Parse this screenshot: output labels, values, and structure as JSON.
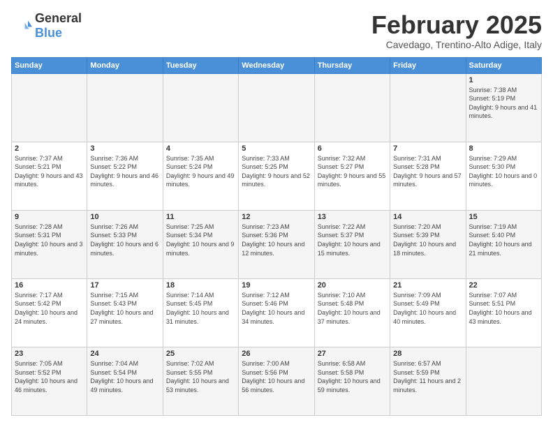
{
  "header": {
    "logo_general": "General",
    "logo_blue": "Blue",
    "month_title": "February 2025",
    "subtitle": "Cavedago, Trentino-Alto Adige, Italy"
  },
  "days_of_week": [
    "Sunday",
    "Monday",
    "Tuesday",
    "Wednesday",
    "Thursday",
    "Friday",
    "Saturday"
  ],
  "weeks": [
    [
      {
        "day": "",
        "info": ""
      },
      {
        "day": "",
        "info": ""
      },
      {
        "day": "",
        "info": ""
      },
      {
        "day": "",
        "info": ""
      },
      {
        "day": "",
        "info": ""
      },
      {
        "day": "",
        "info": ""
      },
      {
        "day": "1",
        "info": "Sunrise: 7:38 AM\nSunset: 5:19 PM\nDaylight: 9 hours and 41 minutes."
      }
    ],
    [
      {
        "day": "2",
        "info": "Sunrise: 7:37 AM\nSunset: 5:21 PM\nDaylight: 9 hours and 43 minutes."
      },
      {
        "day": "3",
        "info": "Sunrise: 7:36 AM\nSunset: 5:22 PM\nDaylight: 9 hours and 46 minutes."
      },
      {
        "day": "4",
        "info": "Sunrise: 7:35 AM\nSunset: 5:24 PM\nDaylight: 9 hours and 49 minutes."
      },
      {
        "day": "5",
        "info": "Sunrise: 7:33 AM\nSunset: 5:25 PM\nDaylight: 9 hours and 52 minutes."
      },
      {
        "day": "6",
        "info": "Sunrise: 7:32 AM\nSunset: 5:27 PM\nDaylight: 9 hours and 55 minutes."
      },
      {
        "day": "7",
        "info": "Sunrise: 7:31 AM\nSunset: 5:28 PM\nDaylight: 9 hours and 57 minutes."
      },
      {
        "day": "8",
        "info": "Sunrise: 7:29 AM\nSunset: 5:30 PM\nDaylight: 10 hours and 0 minutes."
      }
    ],
    [
      {
        "day": "9",
        "info": "Sunrise: 7:28 AM\nSunset: 5:31 PM\nDaylight: 10 hours and 3 minutes."
      },
      {
        "day": "10",
        "info": "Sunrise: 7:26 AM\nSunset: 5:33 PM\nDaylight: 10 hours and 6 minutes."
      },
      {
        "day": "11",
        "info": "Sunrise: 7:25 AM\nSunset: 5:34 PM\nDaylight: 10 hours and 9 minutes."
      },
      {
        "day": "12",
        "info": "Sunrise: 7:23 AM\nSunset: 5:36 PM\nDaylight: 10 hours and 12 minutes."
      },
      {
        "day": "13",
        "info": "Sunrise: 7:22 AM\nSunset: 5:37 PM\nDaylight: 10 hours and 15 minutes."
      },
      {
        "day": "14",
        "info": "Sunrise: 7:20 AM\nSunset: 5:39 PM\nDaylight: 10 hours and 18 minutes."
      },
      {
        "day": "15",
        "info": "Sunrise: 7:19 AM\nSunset: 5:40 PM\nDaylight: 10 hours and 21 minutes."
      }
    ],
    [
      {
        "day": "16",
        "info": "Sunrise: 7:17 AM\nSunset: 5:42 PM\nDaylight: 10 hours and 24 minutes."
      },
      {
        "day": "17",
        "info": "Sunrise: 7:15 AM\nSunset: 5:43 PM\nDaylight: 10 hours and 27 minutes."
      },
      {
        "day": "18",
        "info": "Sunrise: 7:14 AM\nSunset: 5:45 PM\nDaylight: 10 hours and 31 minutes."
      },
      {
        "day": "19",
        "info": "Sunrise: 7:12 AM\nSunset: 5:46 PM\nDaylight: 10 hours and 34 minutes."
      },
      {
        "day": "20",
        "info": "Sunrise: 7:10 AM\nSunset: 5:48 PM\nDaylight: 10 hours and 37 minutes."
      },
      {
        "day": "21",
        "info": "Sunrise: 7:09 AM\nSunset: 5:49 PM\nDaylight: 10 hours and 40 minutes."
      },
      {
        "day": "22",
        "info": "Sunrise: 7:07 AM\nSunset: 5:51 PM\nDaylight: 10 hours and 43 minutes."
      }
    ],
    [
      {
        "day": "23",
        "info": "Sunrise: 7:05 AM\nSunset: 5:52 PM\nDaylight: 10 hours and 46 minutes."
      },
      {
        "day": "24",
        "info": "Sunrise: 7:04 AM\nSunset: 5:54 PM\nDaylight: 10 hours and 49 minutes."
      },
      {
        "day": "25",
        "info": "Sunrise: 7:02 AM\nSunset: 5:55 PM\nDaylight: 10 hours and 53 minutes."
      },
      {
        "day": "26",
        "info": "Sunrise: 7:00 AM\nSunset: 5:56 PM\nDaylight: 10 hours and 56 minutes."
      },
      {
        "day": "27",
        "info": "Sunrise: 6:58 AM\nSunset: 5:58 PM\nDaylight: 10 hours and 59 minutes."
      },
      {
        "day": "28",
        "info": "Sunrise: 6:57 AM\nSunset: 5:59 PM\nDaylight: 11 hours and 2 minutes."
      },
      {
        "day": "",
        "info": ""
      }
    ]
  ]
}
